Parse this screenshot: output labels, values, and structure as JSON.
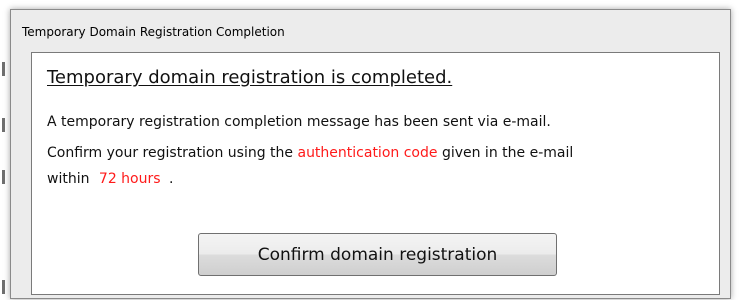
{
  "window": {
    "title": "Temporary Domain Registration Completion"
  },
  "message": {
    "heading": "Temporary domain registration is completed.",
    "sent_notice": "A temporary registration completion message has been sent via e-mail.",
    "confirm_text_before": "Confirm your registration using the",
    "confirm_highlight_code": "authentication code",
    "confirm_text_after": "given in the e-mail",
    "within_label": "within",
    "hours_highlight": "72 hours",
    "period": "."
  },
  "actions": {
    "confirm_button_label": "Confirm domain registration"
  },
  "colors": {
    "highlight": "#ff1a1a",
    "dialog_bg": "#ececec",
    "content_bg": "#ffffff"
  }
}
